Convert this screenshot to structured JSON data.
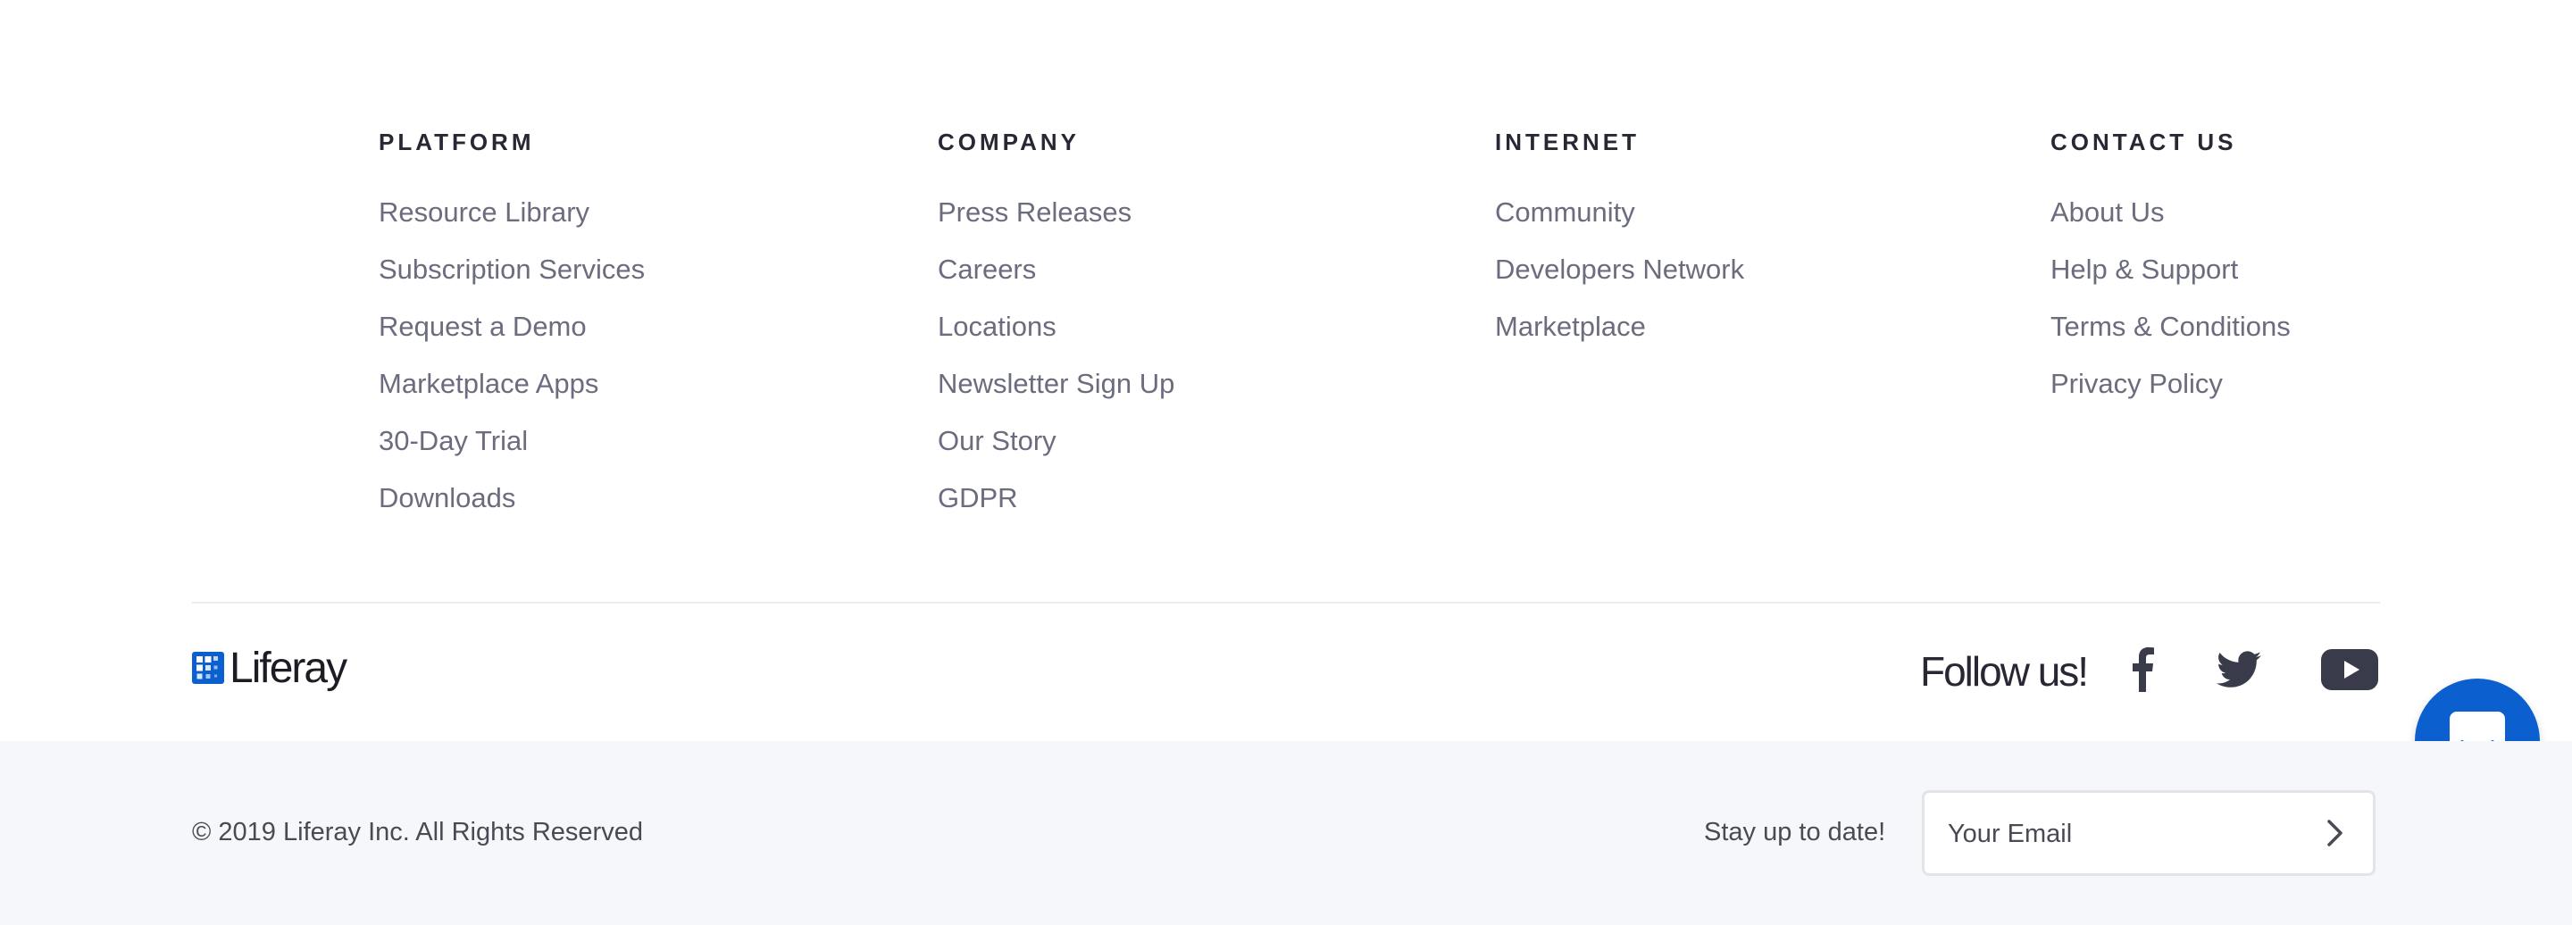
{
  "columns": [
    {
      "heading": "PLATFORM",
      "links": [
        "Resource Library",
        "Subscription Services",
        "Request a Demo",
        "Marketplace Apps",
        "30-Day Trial",
        "Downloads"
      ]
    },
    {
      "heading": "COMPANY",
      "links": [
        "Press Releases",
        "Careers",
        "Locations",
        "Newsletter Sign Up",
        "Our Story",
        "GDPR"
      ]
    },
    {
      "heading": "INTERNET",
      "links": [
        "Community",
        "Developers Network",
        "Marketplace"
      ]
    },
    {
      "heading": "CONTACT US",
      "links": [
        "About Us",
        "Help & Support",
        "Terms & Conditions",
        "Privacy Policy"
      ]
    }
  ],
  "brand": {
    "name": "Liferay",
    "logo_icon": "liferay-logo-icon",
    "color": "#0b5fce"
  },
  "social": {
    "label": "Follow us!",
    "icons": [
      "facebook-icon",
      "twitter-icon",
      "youtube-icon"
    ],
    "color": "#393a4a"
  },
  "bottom": {
    "copyright": "© 2019 Liferay Inc. All Rights Reserved",
    "newsletter_label": "Stay up to date!",
    "email_placeholder": "Your Email",
    "submit_icon": "chevron-right-icon"
  },
  "chat": {
    "icon": "chat-icon",
    "color": "#0b5fce"
  }
}
